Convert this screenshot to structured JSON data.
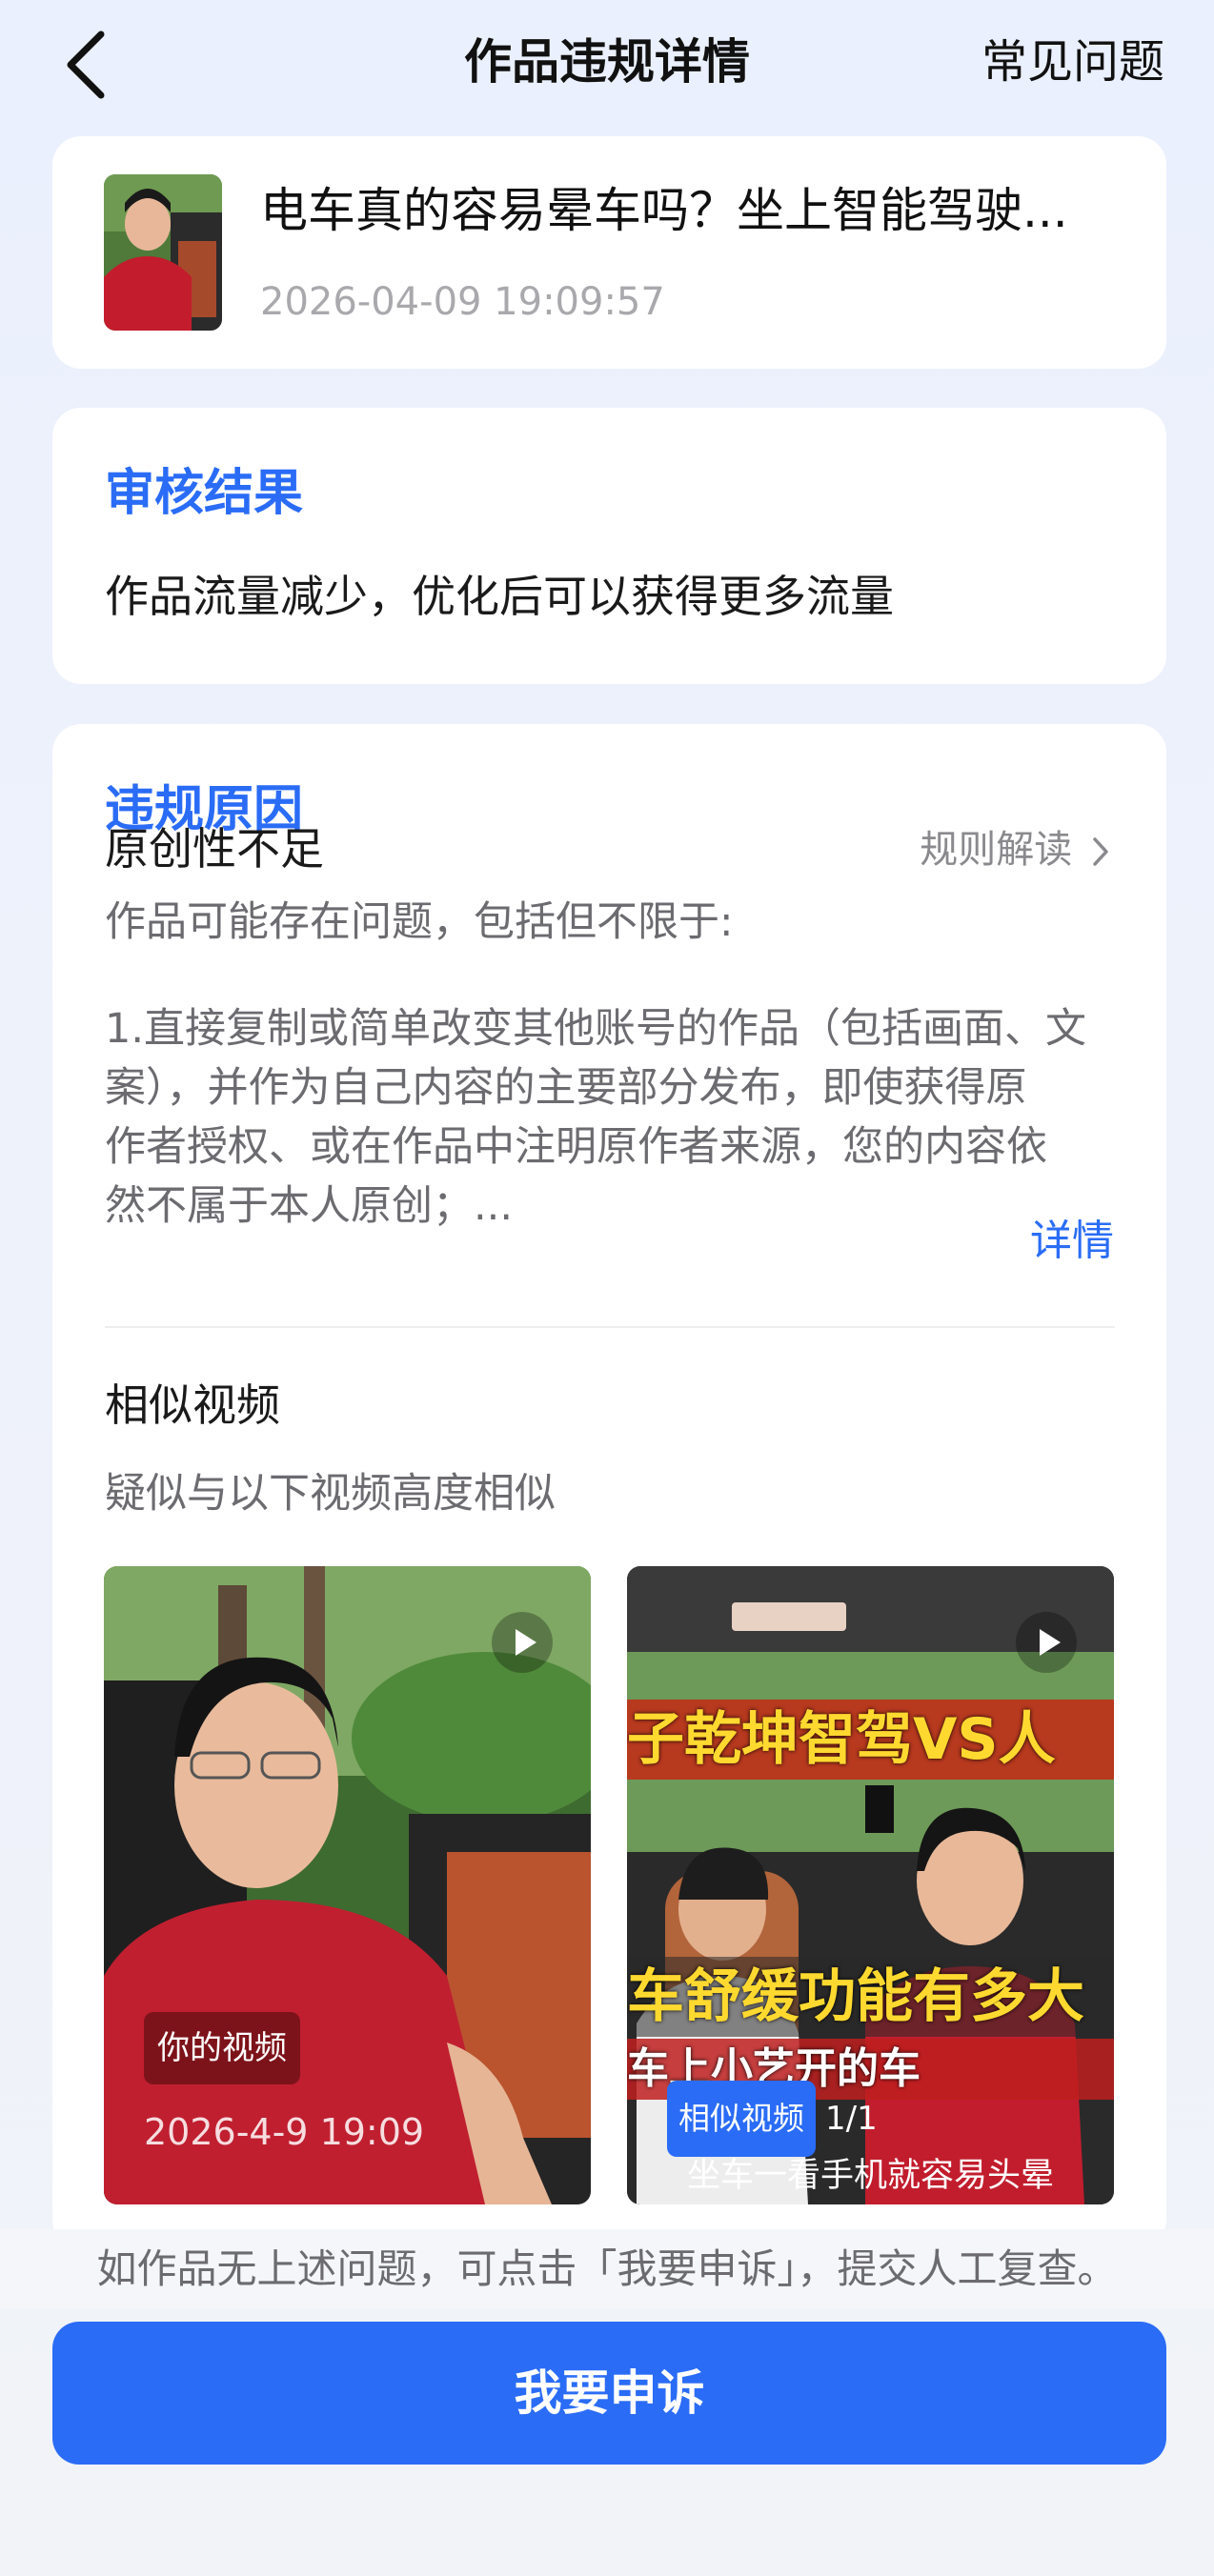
{
  "header": {
    "title": "作品违规详情",
    "faq_label": "常见问题"
  },
  "video": {
    "title": "电车真的容易晕车吗？坐上智能驾驶...",
    "time": "2026-04-09 19:09:57"
  },
  "review": {
    "heading": "审核结果",
    "text": "作品流量减少，优化后可以获得更多流量"
  },
  "violation": {
    "heading": "违规原因",
    "reason": "原创性不足",
    "rule_link": "规则解读",
    "intro": "作品可能存在问题，包括但不限于:",
    "desc_lines": [
      "1.直接复制或简单改变其他账号的作品（包括画面、文",
      "案），并作为自己内容的主要部分发布，即使获得原",
      "作者授权、或在作品中注明原作者来源，您的内容依",
      "然不属于本人原创；..."
    ],
    "detail_link": "详情"
  },
  "similar": {
    "heading": "相似视频",
    "subtitle": "疑似与以下视频高度相似",
    "your_video": {
      "tag": "你的视频",
      "time": "2026-4-9 19:09"
    },
    "other_video": {
      "tag": "相似视频",
      "count": "1/1",
      "overlay_lines": [
        "子乾坤智驾VS人",
        "车舒缓功能有多大",
        "车上小艺开的车"
      ],
      "caption": "坐车一看手机就容易头晕"
    }
  },
  "footer": {
    "note": "如作品无上述问题，可点击「我要申诉」，提交人工复查。",
    "appeal_label": "我要申诉"
  },
  "colors": {
    "accent": "#2a6cf6",
    "background": "#eef2fb"
  }
}
